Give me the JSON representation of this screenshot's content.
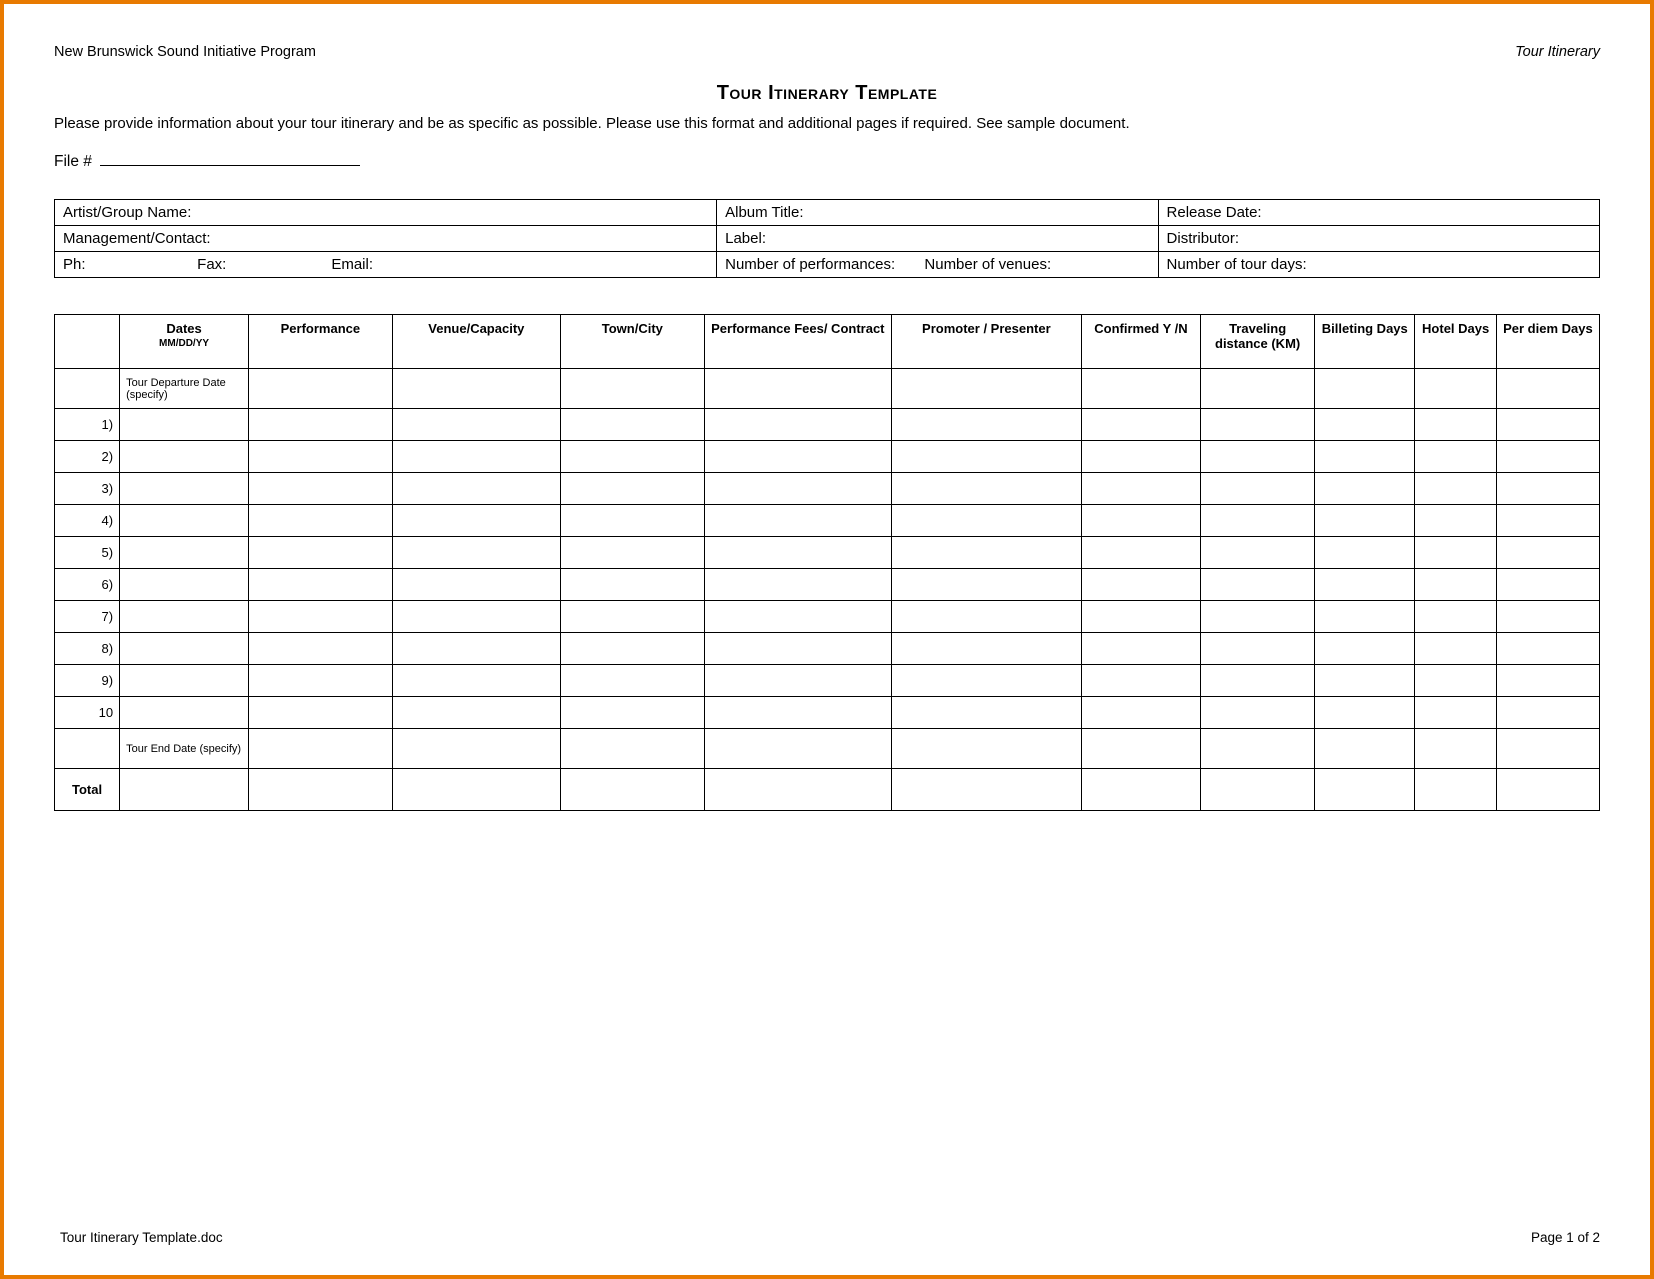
{
  "header": {
    "program": "New Brunswick Sound Initiative Program",
    "doc_type": "Tour Itinerary"
  },
  "title": "Tour Itinerary Template",
  "instructions": "Please provide information about your tour itinerary and be as specific as possible. Please use this format and additional pages if required.  See sample document.",
  "file_label": "File #",
  "info": {
    "artist_label": "Artist/Group Name:",
    "album_label": "Album Title:",
    "release_label": "Release Date:",
    "mgmt_label": "Management/Contact:",
    "label_label": "Label:",
    "distributor_label": "Distributor:",
    "ph_label": "Ph:",
    "fax_label": "Fax:",
    "email_label": "Email:",
    "num_perf_label": "Number of performances:",
    "num_venues_label": "Number of venues:",
    "num_days_label": "Number of tour days:"
  },
  "sched": {
    "headers": {
      "dates": "Dates",
      "dates_sub": "MM/DD/YY",
      "performance": "Performance",
      "venue": "Venue/Capacity",
      "town": "Town/City",
      "fees": "Performance Fees/ Contract",
      "promoter": "Promoter / Presenter",
      "confirmed": "Confirmed Y /N",
      "traveling": "Traveling distance (KM)",
      "billeting": "Billeting Days",
      "hotel": "Hotel Days",
      "perdiem": "Per diem Days"
    },
    "departure_note": "Tour Departure Date (specify)",
    "end_note": "Tour End Date (specify)",
    "rows": [
      "1)",
      "2)",
      "3)",
      "4)",
      "5)",
      "6)",
      "7)",
      "8)",
      "9)",
      "10"
    ],
    "total_label": "Total"
  },
  "footer": {
    "filename": "Tour Itinerary Template.doc",
    "page": "Page 1 of 2"
  }
}
